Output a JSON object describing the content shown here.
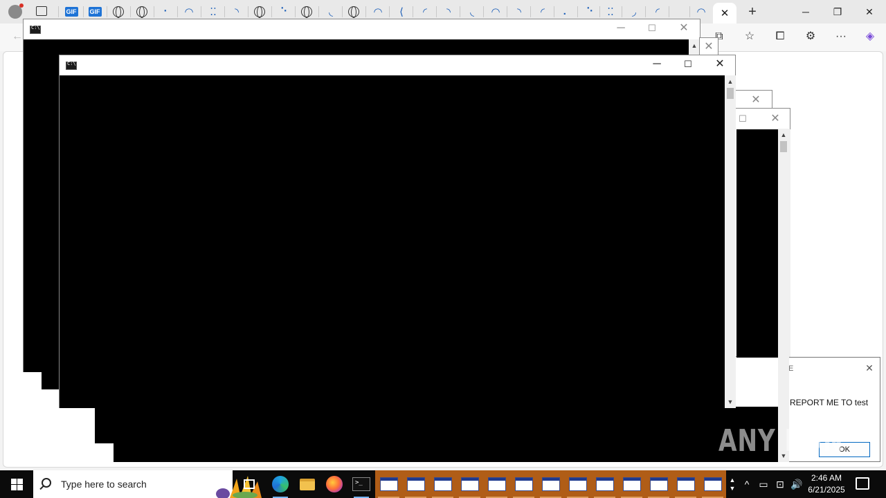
{
  "browser": {
    "tab_icons": [
      "profile-avatar",
      "tab-actions",
      "gif-icon",
      "gif-icon",
      "globe-icon",
      "globe-icon",
      "loading-arc",
      "loading-arc",
      "loading-arc",
      "loading-arc",
      "globe-icon",
      "loading-arc",
      "globe-icon",
      "loading-arc",
      "globe-icon",
      "loading-arc",
      "loading-arc",
      "loading-arc",
      "loading-arc",
      "loading-arc",
      "loading-arc",
      "loading-arc",
      "loading-arc",
      "loading-arc",
      "loading-arc",
      "loading-arc",
      "loading-arc",
      "loading-arc",
      "loading-arc"
    ],
    "gif_label": "GIF",
    "new_tab_glyph": "+",
    "minimize_glyph": "─",
    "restore_glyph": "❐",
    "close_glyph": "✕",
    "back_glyph": "←",
    "toolbar_glyphs": {
      "split": "⧉",
      "favorites": "☆",
      "collections": "⧠",
      "extensions": "⚙",
      "more": "···",
      "copilot": "◈"
    }
  },
  "console_windows": [
    {
      "id": "cmd-back",
      "title_icon": "cmd-icon",
      "minimize": "─",
      "maximize": "☐",
      "close": "✕"
    },
    {
      "id": "cmd-front",
      "title_icon": "cmd-icon",
      "minimize": "─",
      "maximize": "☐",
      "close": "✕"
    }
  ],
  "dialog": {
    "title": "E",
    "message": "REPORT ME TO test",
    "ok_label": "OK",
    "close_glyph": "✕"
  },
  "watermark": {
    "text": "ANY RUN"
  },
  "taskbar": {
    "search_placeholder": "Type here to search",
    "pinned": [
      "task-view",
      "edge",
      "file-explorer",
      "firefox",
      "command-prompt"
    ],
    "window_group_count": 13,
    "tray_glyphs": {
      "chevron": "^",
      "meet": "▭",
      "network": "⊡",
      "volume": "🔊"
    },
    "clock_time": "2:46 AM",
    "clock_date": "6/21/2025"
  },
  "colors": {
    "console_bg": "#000000",
    "taskbar_bg": "#0b0b0b",
    "taskbar_group": "#b05d17",
    "accent": "#0067c0"
  }
}
